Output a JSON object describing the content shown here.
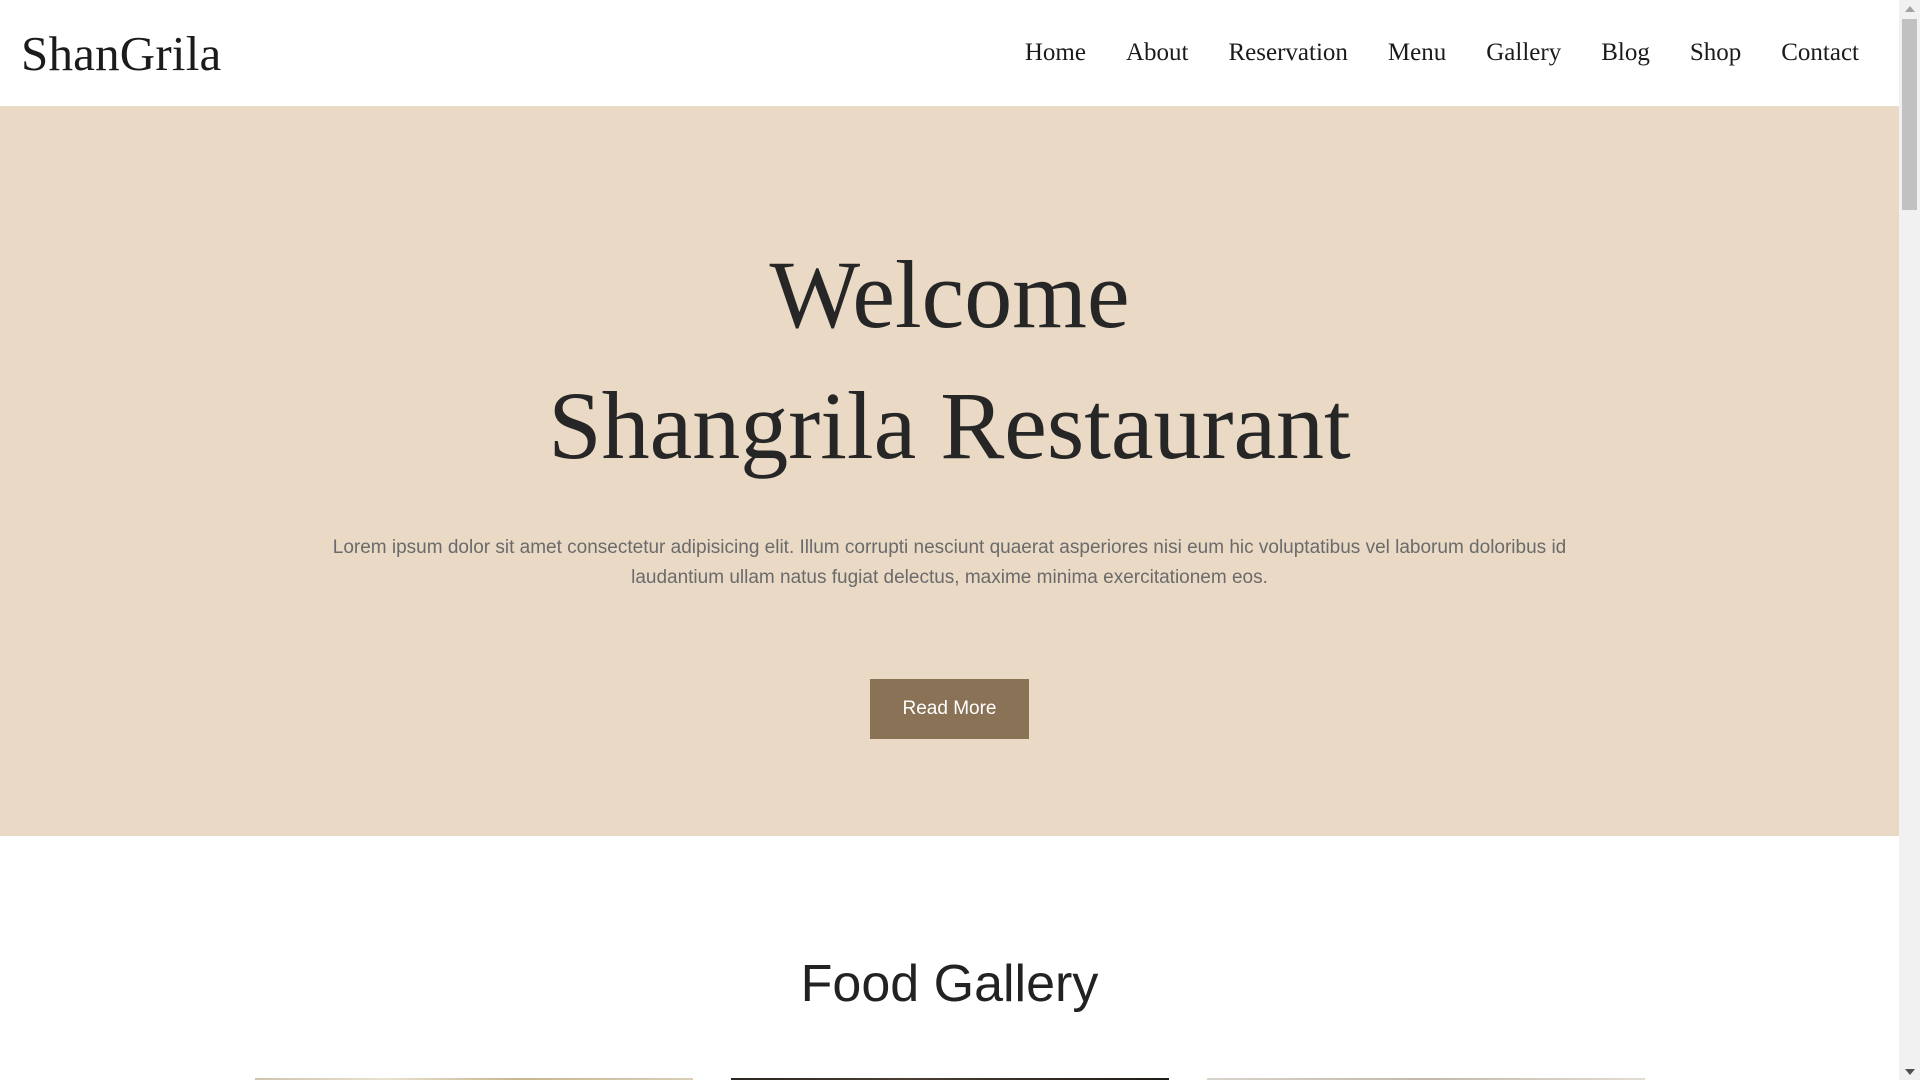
{
  "navbar": {
    "brand": "ShanGrila",
    "links": [
      "Home",
      "About",
      "Reservation",
      "Menu",
      "Gallery",
      "Blog",
      "Shop",
      "Contact"
    ]
  },
  "hero": {
    "title_line1": "Welcome",
    "title_line2": "Shangrila Restaurant",
    "text": "Lorem ipsum dolor sit amet consectetur adipisicing elit. Illum corrupti nesciunt quaerat asperiores nisi eum hic voluptatibus vel laborum doloribus id laudantium ullam natus fugiat delectus, maxime minima exercitationem eos.",
    "button_label": "Read More"
  },
  "gallery": {
    "title": "Food Gallery"
  },
  "colors": {
    "hero_background": "#e9d9c5",
    "button_background": "#8a7256",
    "text_dark": "#262626",
    "text_muted": "#6b6b6b"
  }
}
